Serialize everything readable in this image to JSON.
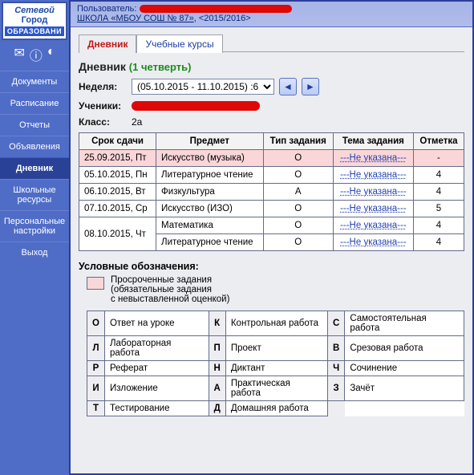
{
  "brand": {
    "line1": "Сетевой",
    "line2": "Город",
    "line3": "ОБРАЗОВАНИ"
  },
  "header": {
    "user_label": "Пользователь:",
    "school_link": "ШКОЛА «МБОУ СОШ № 87»",
    "year": "<2015/2016>"
  },
  "nav": {
    "items": [
      "Документы",
      "Расписание",
      "Отчеты",
      "Объявления",
      "Дневник",
      "Школьные ресурсы",
      "Персональные настройки",
      "Выход"
    ],
    "active_index": 4
  },
  "tabs": {
    "items": [
      "Дневник",
      "Учебные курсы"
    ],
    "active_index": 0
  },
  "page": {
    "title": "Дневник",
    "term": "(1 четверть)",
    "week_label": "Неделя:",
    "week_value": "(05.10.2015 - 11.10.2015) :6",
    "students_label": "Ученики:",
    "class_label": "Класс:",
    "class_value": "2а"
  },
  "table": {
    "headers": [
      "Срок сдачи",
      "Предмет",
      "Тип задания",
      "Тема задания",
      "Отметка"
    ],
    "rows": [
      {
        "date": "25.09.2015, Пт",
        "subject": "Искусство (музыка)",
        "type": "О",
        "topic": "---Не указана---",
        "mark": "-",
        "overdue": true
      },
      {
        "date": "05.10.2015, Пн",
        "subject": "Литературное чтение",
        "type": "О",
        "topic": "---Не указана---",
        "mark": "4",
        "overdue": false
      },
      {
        "date": "06.10.2015, Вт",
        "subject": "Физкультура",
        "type": "А",
        "topic": "---Не указана---",
        "mark": "4",
        "overdue": false
      },
      {
        "date": "07.10.2015, Ср",
        "subject": "Искусство (ИЗО)",
        "type": "О",
        "topic": "---Не указана---",
        "mark": "5",
        "overdue": false
      },
      {
        "date": "08.10.2015, Чт",
        "subject": "Математика",
        "type": "О",
        "topic": "---Не указана---",
        "mark": "4",
        "overdue": false,
        "span": 2
      },
      {
        "date": "",
        "subject": "Литературное чтение",
        "type": "О",
        "topic": "---Не указана---",
        "mark": "4",
        "overdue": false
      }
    ]
  },
  "legend": {
    "title": "Условные обозначения:",
    "overdue_line1": "Просроченные задания",
    "overdue_line2": "(обязательные задания",
    "overdue_line3": "с невыставленной оценкой)",
    "abbr": [
      {
        "k": "О",
        "v": "Ответ на уроке"
      },
      {
        "k": "К",
        "v": "Контрольная работа"
      },
      {
        "k": "С",
        "v": "Самостоятельная работа"
      },
      {
        "k": "Л",
        "v": "Лабораторная работа"
      },
      {
        "k": "П",
        "v": "Проект"
      },
      {
        "k": "В",
        "v": "Срезовая работа"
      },
      {
        "k": "Р",
        "v": "Реферат"
      },
      {
        "k": "Н",
        "v": "Диктант"
      },
      {
        "k": "Ч",
        "v": "Сочинение"
      },
      {
        "k": "И",
        "v": "Изложение"
      },
      {
        "k": "А",
        "v": "Практическая работа"
      },
      {
        "k": "З",
        "v": "Зачёт"
      },
      {
        "k": "Т",
        "v": "Тестирование"
      },
      {
        "k": "Д",
        "v": "Домашняя работа"
      }
    ]
  }
}
